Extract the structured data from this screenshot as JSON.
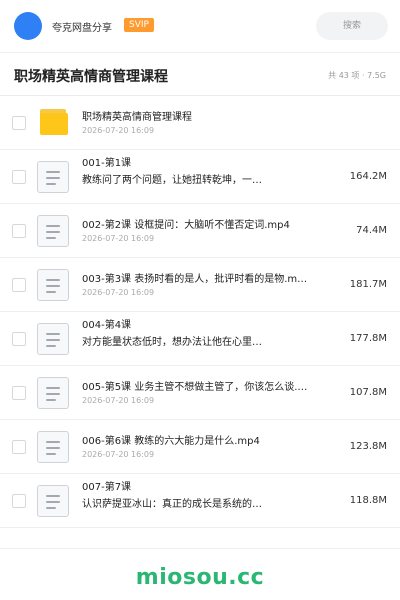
{
  "header": {
    "user_name": "夸克网盘分享",
    "badge": "SVIP",
    "search_placeholder": "搜索"
  },
  "title_bar": {
    "title": "职场精英高情商管理课程",
    "summary": "共 43 项 · 7.5G"
  },
  "items": [
    {
      "type": "folder",
      "name": "职场精英高情商管理课程",
      "date": "2026-07-20 16:09",
      "size": ""
    },
    {
      "type": "file",
      "name": "001-第1课",
      "name2": "教练问了两个问题，让她扭转乾坤，一…",
      "date": "",
      "size": "164.2M"
    },
    {
      "type": "file",
      "name": "002-第2课 设框提问：大脑听不懂否定词.mp4",
      "date": "2026-07-20 16:09",
      "size": "74.4M"
    },
    {
      "type": "file",
      "name": "003-第3课 表扬时看的是人，批评时看的是物.m…",
      "date": "2026-07-20 16:09",
      "size": "181.7M"
    },
    {
      "type": "file",
      "name": "004-第4课",
      "name2": "对方能量状态低时，想办法让他在心里…",
      "date": "",
      "size": "177.8M"
    },
    {
      "type": "file",
      "name": "005-第5课 业务主管不想做主管了，你该怎么谈.…",
      "date": "2026-07-20 16:09",
      "size": "107.8M"
    },
    {
      "type": "file",
      "name": "006-第6课 教练的六大能力是什么.mp4",
      "date": "2026-07-20 16:09",
      "size": "123.8M"
    },
    {
      "type": "file",
      "name": "007-第7课",
      "name2": "认识萨提亚冰山：真正的成长是系统的…",
      "date": "",
      "size": "118.8M"
    }
  ],
  "footer": {
    "watermark": "miosou.cc"
  },
  "colors": {
    "avatar": "#2f80f5",
    "badge": "#ff9a2e",
    "folder": "#ffc61a",
    "watermark": "#2bb673"
  }
}
